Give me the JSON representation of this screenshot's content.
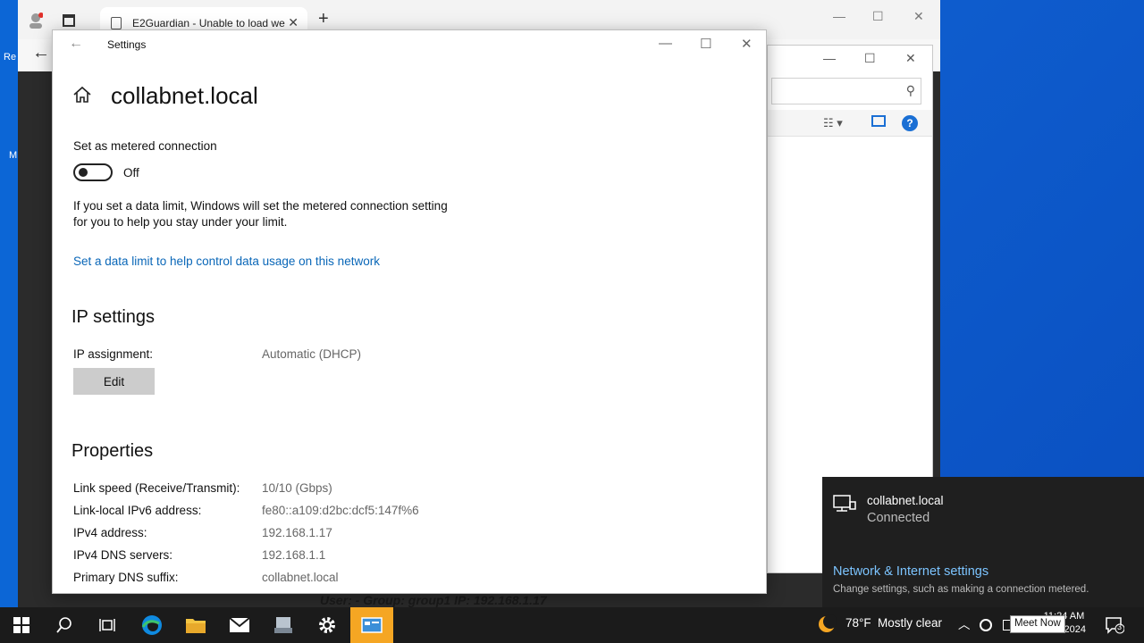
{
  "desktop": {
    "left_labels": [
      "Re",
      "M"
    ]
  },
  "browser": {
    "tab_title": "E2Guardian - Unable to load we",
    "status_line": "User: -   Group: group1   IP: 192.168.1.17"
  },
  "settings": {
    "window_title": "Settings",
    "page_title": "collabnet.local",
    "metered": {
      "label": "Set as metered connection",
      "state": "Off",
      "note_line1": "If you set a data limit, Windows will set the metered connection setting",
      "note_line2": "for you to help you stay under your limit.",
      "link": "Set a data limit to help control data usage on this network"
    },
    "ip_settings": {
      "heading": "IP settings",
      "assignment_label": "IP assignment:",
      "assignment_value": "Automatic (DHCP)",
      "edit_label": "Edit"
    },
    "properties": {
      "heading": "Properties",
      "rows": [
        {
          "label": "Link speed (Receive/Transmit):",
          "value": "10/10 (Gbps)"
        },
        {
          "label": "Link-local IPv6 address:",
          "value": "fe80::a109:d2bc:dcf5:147f%6"
        },
        {
          "label": "IPv4 address:",
          "value": "192.168.1.17"
        },
        {
          "label": "IPv4 DNS servers:",
          "value": "192.168.1.1"
        },
        {
          "label": "Primary DNS suffix:",
          "value": "collabnet.local"
        }
      ]
    }
  },
  "flyout": {
    "network_name": "collabnet.local",
    "network_status": "Connected",
    "settings_link": "Network & Internet settings",
    "settings_desc": "Change settings, such as making a connection metered."
  },
  "taskbar": {
    "weather_temp": "78°F",
    "weather_text": "Mostly clear",
    "tooltip": "Meet Now",
    "time": "11:24 AM",
    "date": "7/12/2024",
    "notification_count": "3"
  },
  "colors": {
    "accent_link": "#0a67b8",
    "flyout_link": "#7cc4ff",
    "active_app": "#f5a623"
  }
}
